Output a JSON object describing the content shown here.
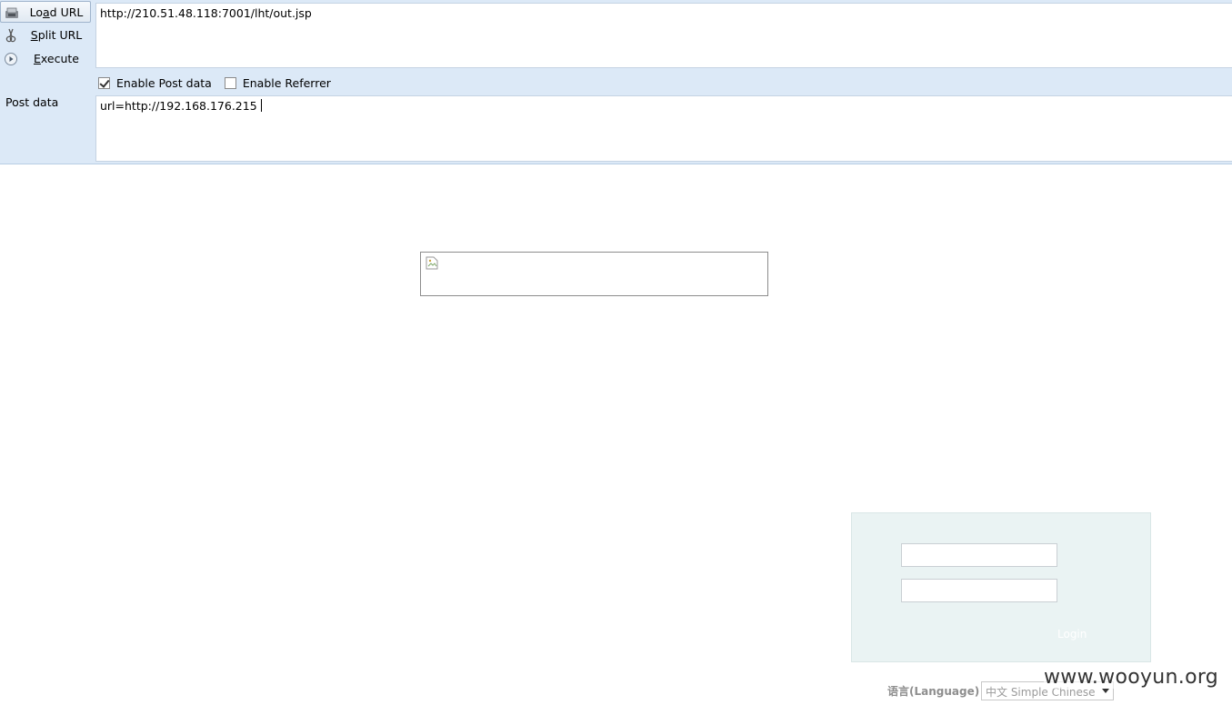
{
  "hackbar": {
    "load_url": {
      "pre": "Lo",
      "key": "a",
      "post": "d URL"
    },
    "split_url": {
      "pre": "",
      "key": "S",
      "post": "plit URL"
    },
    "execute": {
      "pre": "",
      "key": "E",
      "post": "xecute"
    },
    "url_value": "http://210.51.48.118:7001/lht/out.jsp",
    "enable_post_data": {
      "label": "Enable Post data",
      "checked": true
    },
    "enable_referrer": {
      "label": "Enable Referrer",
      "checked": false
    },
    "post_data_label": "Post data",
    "post_data_value": "url=http://192.168.176.215"
  },
  "login": {
    "button_label": "Login",
    "language_label": "语言(Language)：",
    "language_value": "中文 Simple Chinese"
  },
  "watermark": "www.wooyun.org",
  "icons": {
    "load": "load-url-icon",
    "split": "scissors-icon",
    "execute": "play-circle-icon",
    "broken": "broken-image-icon"
  },
  "colors": {
    "toolbar_bg": "#dce9f7",
    "login_panel_bg": "#eaf3f3"
  }
}
